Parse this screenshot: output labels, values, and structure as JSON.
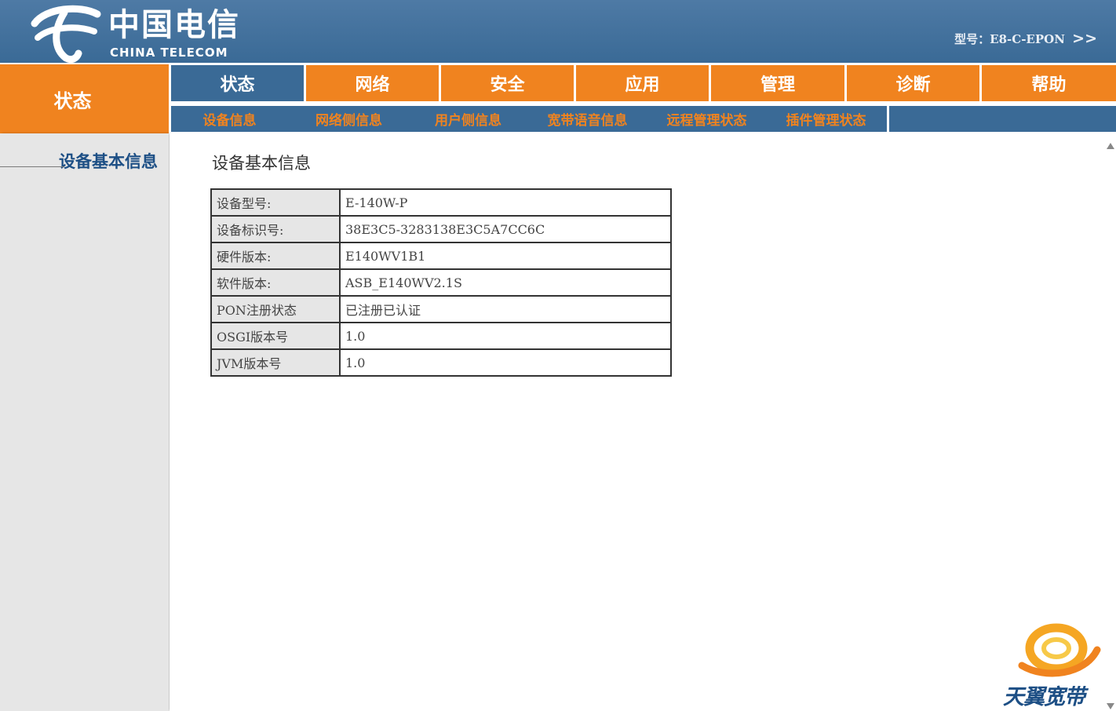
{
  "header": {
    "logo_cn": "中国电信",
    "logo_en": "CHINA TELECOM",
    "model_text": "型号：E8-C-EPON",
    "model_arrows": ">>"
  },
  "sidebar": {
    "title": "状态",
    "items": [
      {
        "label": "设备基本信息"
      }
    ]
  },
  "topnav": {
    "tabs": [
      {
        "label": "状态",
        "active": true
      },
      {
        "label": "网络",
        "active": false
      },
      {
        "label": "安全",
        "active": false
      },
      {
        "label": "应用",
        "active": false
      },
      {
        "label": "管理",
        "active": false
      },
      {
        "label": "诊断",
        "active": false
      },
      {
        "label": "帮助",
        "active": false
      }
    ]
  },
  "subnav": {
    "tabs": [
      {
        "label": "设备信息"
      },
      {
        "label": "网络侧信息"
      },
      {
        "label": "用户侧信息"
      },
      {
        "label": "宽带语音信息"
      },
      {
        "label": "远程管理状态"
      },
      {
        "label": "插件管理状态"
      }
    ]
  },
  "main": {
    "title": "设备基本信息",
    "rows": [
      {
        "label": "设备型号:",
        "value": "E-140W-P"
      },
      {
        "label": "设备标识号:",
        "value": "38E3C5-3283138E3C5A7CC6C"
      },
      {
        "label": "硬件版本:",
        "value": "E140WV1B1"
      },
      {
        "label": "软件版本:",
        "value": "ASB_E140WV2.1S"
      },
      {
        "label": "PON注册状态",
        "value": "已注册已认证"
      },
      {
        "label": "OSGI版本号",
        "value": "1.0"
      },
      {
        "label": "JVM版本号",
        "value": "1.0"
      }
    ]
  },
  "brand": {
    "text": "天翼宽带"
  },
  "colors": {
    "header_blue": "#3a6a96",
    "accent_orange": "#f0831f",
    "sidebar_gray": "#e6e6e6",
    "sidebar_link": "#1d4f85"
  },
  "icons": {
    "logo": "china-telecom-logo-icon",
    "brand": "tianyi-broadband-logo-icon"
  }
}
